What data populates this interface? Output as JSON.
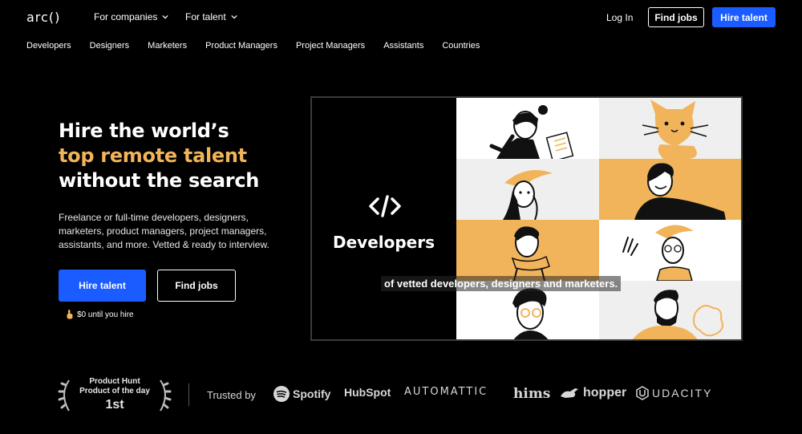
{
  "header": {
    "logo": "arc()",
    "menus": [
      {
        "label": "For companies"
      },
      {
        "label": "For talent"
      }
    ],
    "login": "Log In",
    "find_jobs": "Find jobs",
    "hire_talent": "Hire talent"
  },
  "subnav": [
    "Developers",
    "Designers",
    "Marketers",
    "Product Managers",
    "Project Managers",
    "Assistants",
    "Countries"
  ],
  "hero": {
    "line1": "Hire the world’s",
    "line2": "top remote talent",
    "line3": "without the search",
    "description": "Freelance or full-time developers, designers, marketers, product managers, project managers, assistants, and more. Vetted & ready to interview.",
    "cta_primary": "Hire talent",
    "cta_secondary": "Find jobs",
    "note": "$0 until you hire"
  },
  "media": {
    "title": "Developers",
    "caption": "of vetted developers, designers and marketers."
  },
  "trust": {
    "ph_line1": "Product Hunt",
    "ph_line2": "Product of the day",
    "ph_rank": "1st",
    "label": "Trusted by",
    "brands": [
      "Spotify",
      "HubSpot",
      "AUTOMATTIC",
      "hims",
      "hopper",
      "UDACITY"
    ]
  },
  "colors": {
    "accent": "#f1b45a",
    "primary_blue": "#1a5cff"
  }
}
